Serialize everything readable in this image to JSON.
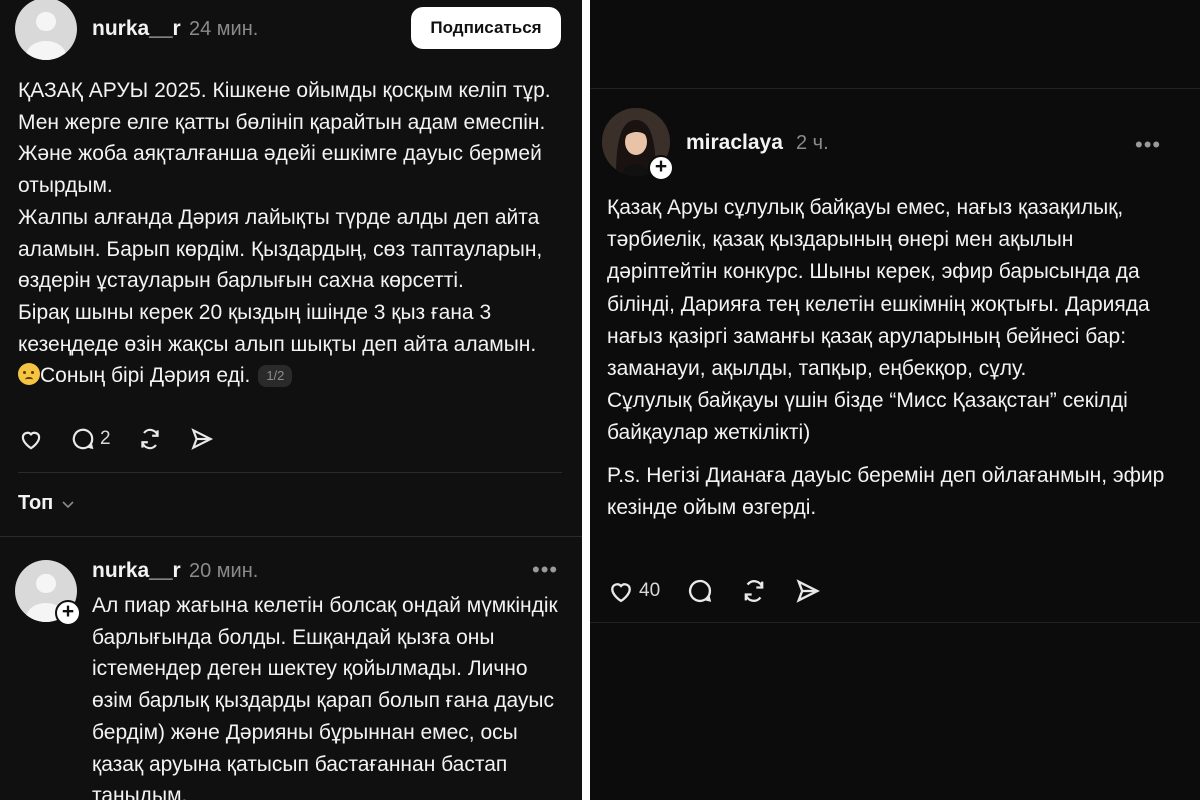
{
  "left": {
    "post": {
      "username": "nurka__r",
      "time": "24 мин.",
      "subscribe_label": "Подписаться",
      "paragraphs": [
        "ҚАЗАҚ АРУЫ 2025. Кішкене ойымды қосқым келіп тұр. Мен жерге елге қатты бөлініп қарайтын адам емеспін. Және жоба аяқталғанша әдейі ешкімге дауыс бермей отырдым.",
        " Жалпы алғанда Дәрия лайықты түрде алды деп айта аламын. Барып көрдім. Қыздардың, сөз таптауларын, өздерін ұстауларын барлығын сахна көрсетті.",
        "Бірақ шыны керек 20 қыздың ішінде 3 қыз ғана 3 кезеңдеде өзін жақсы алып шықты деп айта аламын."
      ],
      "last_line_tail": "Соның бірі Дәрия еді.",
      "page_indicator": "1/2",
      "reply_count": "2"
    },
    "sort": {
      "label": "Топ"
    },
    "reply": {
      "username": "nurka__r",
      "time": "20 мин.",
      "text": "Ал пиар жағына келетін болсақ ондай мүмкіндік барлығында болды.  Ешқандай қызға оны істемендер деген шектеу қойылмады. Лично өзім барлық қыздарды қарап болып ғана дауыс бердім) және Дәрияны бұрыннан емес, осы қазақ аруына қатысып бастағаннан бастап таныдым."
    }
  },
  "right": {
    "post": {
      "username": "miraclaya",
      "time": "2 ч.",
      "paragraphs": [
        "Қазақ Аруы сұлулық байқауы емес, нағыз қазақилық, тәрбиелік, қазақ қыздарының өнері мен ақылын дәріптейтін конкурс. Шыны керек, эфир барысында да білінді, Дарияға тең келетін ешкімнің жоқтығы. Дарияда нағыз қазіргі заманғы қазақ аруларының бейнесі бар: заманауи, ақылды, тапқыр, еңбекқор, сұлу.",
        "Сұлулық байқауы үшін бізде “Мисс Қазақстан” секілді байқаулар жеткілікті)",
        "P.s. Негізі Дианаға дауыс беремін деп ойлағанмын, эфир кезінде ойым өзгерді."
      ],
      "like_count": "40"
    }
  },
  "icons": {
    "like": "heart-icon",
    "reply": "comment-icon",
    "repost": "repost-icon",
    "share": "send-icon",
    "more": "more-icon",
    "follow": "plus-icon",
    "sort": "chevron-down-icon"
  },
  "colors": {
    "background": "#101010",
    "text": "#f3f3f3",
    "muted": "#8a8a8a",
    "divider": "#2a2a2a",
    "button": "#ffffff"
  }
}
